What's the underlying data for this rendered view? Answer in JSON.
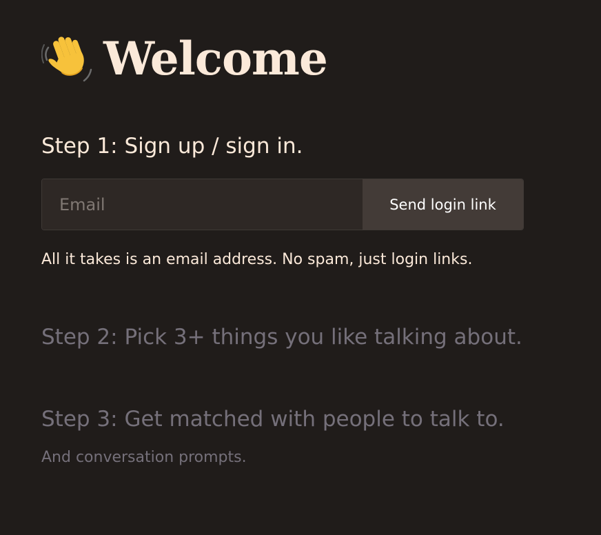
{
  "header": {
    "icon": "waving-hand-icon",
    "title": "Welcome"
  },
  "step1": {
    "heading": "Step 1: Sign up / sign in.",
    "email_placeholder": "Email",
    "email_value": "",
    "send_label": "Send login link",
    "hint": "All it takes is an email address. No spam, just login links."
  },
  "step2": {
    "heading": "Step 2: Pick 3+ things you like talking about."
  },
  "step3": {
    "heading": "Step 3: Get matched with people to talk to.",
    "subtext": "And conversation prompts."
  },
  "colors": {
    "background": "#201c1a",
    "primary_text": "#fbe9d9",
    "muted_text": "#75707a",
    "input_bg": "#2e2825",
    "button_bg": "#433b37"
  }
}
